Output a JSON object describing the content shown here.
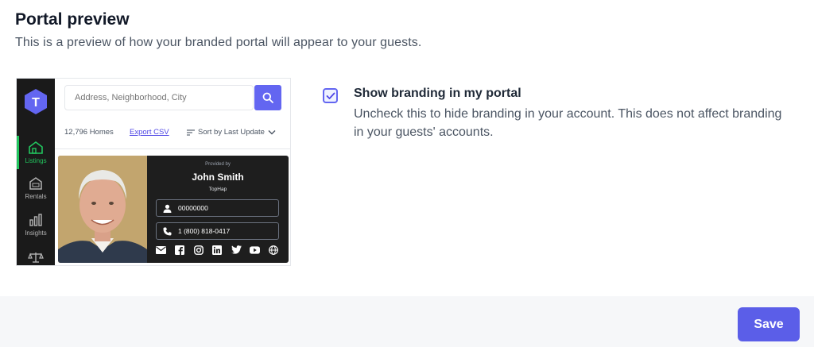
{
  "header": {
    "title": "Portal preview",
    "subtitle": "This is a preview of how your branded portal will appear to your guests."
  },
  "preview": {
    "logo_letter": "T",
    "nav": [
      {
        "label": "Listings",
        "icon": "home-icon",
        "active": true
      },
      {
        "label": "Rentals",
        "icon": "rent-sign-icon",
        "active": false
      },
      {
        "label": "Insights",
        "icon": "bar-chart-icon",
        "active": false
      },
      {
        "label": "",
        "icon": "scales-icon",
        "active": false
      }
    ],
    "search": {
      "placeholder": "Address, Neighborhood, City"
    },
    "homes_count": "12,796 Homes",
    "export_label": "Export CSV",
    "sort_label": "Sort by Last Update",
    "agent": {
      "provided_by": "Provided by",
      "name": "John Smith",
      "company": "TopHap",
      "license": "00000000",
      "phone": "1 (800) 818-0417",
      "socials": [
        "mail-icon",
        "facebook-icon",
        "instagram-icon",
        "linkedin-icon",
        "twitter-icon",
        "youtube-icon",
        "globe-icon"
      ]
    }
  },
  "branding": {
    "checked": true,
    "label": "Show branding in my portal",
    "description": "Uncheck this to hide branding in your account. This does not affect branding in your guests' accounts."
  },
  "footer": {
    "save_label": "Save"
  },
  "colors": {
    "accent": "#5b5ee8",
    "nav_active": "#22c55e",
    "nav_bg": "#1a1a1a"
  }
}
